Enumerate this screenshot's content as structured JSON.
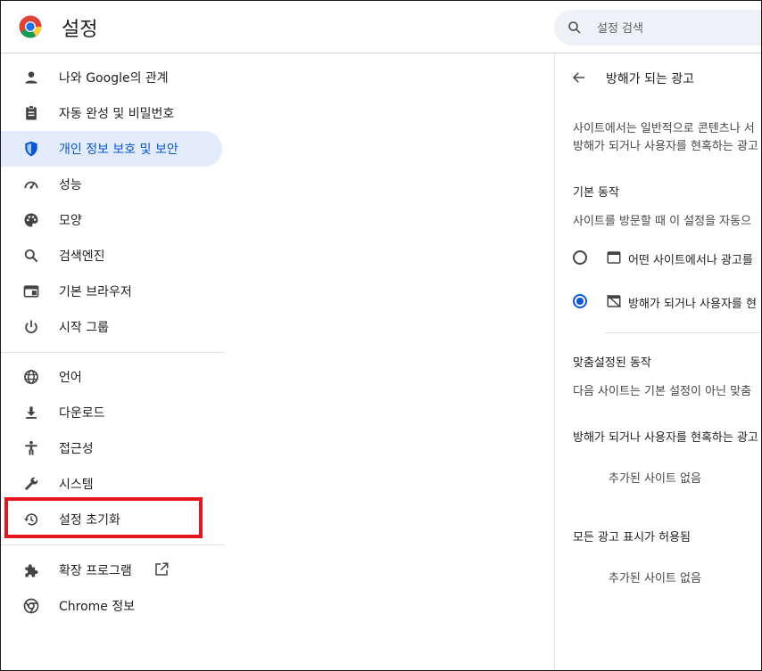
{
  "header": {
    "title": "설정",
    "search_placeholder": "설정 검색"
  },
  "sidebar": {
    "items": [
      {
        "label": "나와 Google의 관계",
        "icon": "person-icon"
      },
      {
        "label": "자동 완성 및 비밀번호",
        "icon": "clipboard-icon"
      },
      {
        "label": "개인 정보 보호 및 보안",
        "icon": "shield-icon",
        "active": true
      },
      {
        "label": "성능",
        "icon": "speedometer-icon"
      },
      {
        "label": "모양",
        "icon": "palette-icon"
      },
      {
        "label": "검색엔진",
        "icon": "search-icon"
      },
      {
        "label": "기본 브라우저",
        "icon": "browser-window-icon"
      },
      {
        "label": "시작 그룹",
        "icon": "power-icon"
      },
      {
        "label": "언어",
        "icon": "globe-icon"
      },
      {
        "label": "다운로드",
        "icon": "download-icon"
      },
      {
        "label": "접근성",
        "icon": "accessibility-icon"
      },
      {
        "label": "시스템",
        "icon": "wrench-icon"
      },
      {
        "label": "설정 초기화",
        "icon": "history-icon",
        "highlighted": true
      },
      {
        "label": "확장 프로그램",
        "icon": "puzzle-icon"
      },
      {
        "label": "Chrome 정보",
        "icon": "chrome-icon"
      }
    ]
  },
  "panel": {
    "title": "방해가 되는 광고",
    "desc_line1": "사이트에서는 일반적으로 콘텐츠나 서",
    "desc_line2": "방해가 되거나 사용자를 현혹하는 광고",
    "default_heading": "기본 동작",
    "default_desc": "사이트를 방문할 때 이 설정을 자동으",
    "option1": "어떤 사이트에서나 광고를",
    "option2": "방해가 되거나 사용자를 현",
    "custom_heading": "맞춤설정된 동작",
    "custom_desc": "다음 사이트는 기본 설정이 아닌 맞춤",
    "blocked_label": "방해가 되거나 사용자를 현혹하는 광고",
    "no_sites_1": "추가된 사이트 없음",
    "allowed_label": "모든 광고 표시가 허용됨",
    "no_sites_2": "추가된 사이트 없음"
  },
  "colors": {
    "accent": "#0b57d0",
    "active_bg": "#e3ecfb",
    "highlight_border": "#e5161f"
  }
}
